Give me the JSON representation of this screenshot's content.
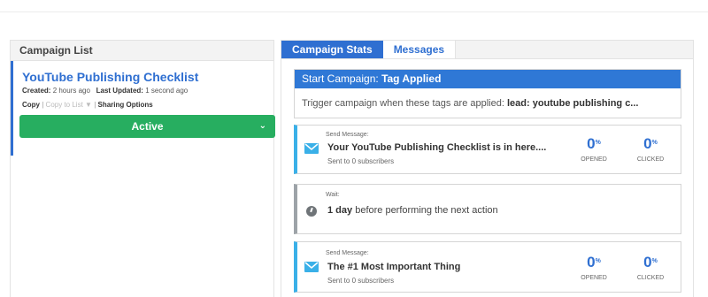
{
  "left": {
    "header": "Campaign List",
    "campaign": {
      "title": "YouTube Publishing Checklist",
      "created_label": "Created:",
      "created_value": "2 hours ago",
      "updated_label": "Last Updated:",
      "updated_value": "1 second ago",
      "copy": "Copy",
      "sep1": "|",
      "copy_to_list": "Copy to List",
      "filter_glyph": "▼",
      "sep2": "|",
      "sharing": "Sharing Options",
      "status_button": "Active",
      "status_chevron": "⌄"
    }
  },
  "tabs": [
    "Campaign Stats",
    "Messages"
  ],
  "start": {
    "prefix": "Start Campaign:",
    "trigger": "Tag Applied",
    "body_prefix": "Trigger campaign when these tags are applied:",
    "tag": "lead: youtube publishing c..."
  },
  "cards": [
    {
      "label": "Send Message:",
      "title": "Your YouTube Publishing Checklist is in here....",
      "sub": "Sent to 0 subscribers",
      "opened_value": "0",
      "opened_caption": "OPENED",
      "clicked_value": "0",
      "clicked_caption": "CLICKED",
      "percent": "%"
    },
    {
      "label": "Wait:",
      "duration": "1 day",
      "rest": "before performing the next action"
    },
    {
      "label": "Send Message:",
      "title": "The #1 Most Important Thing",
      "sub": "Sent to 0 subscribers",
      "opened_value": "0",
      "opened_caption": "OPENED",
      "clicked_value": "0",
      "clicked_caption": "CLICKED",
      "percent": "%"
    }
  ],
  "colors": {
    "accent": "#2f6fd1",
    "active_green": "#27ae60",
    "message_stripe": "#3ab0e8",
    "wait_stripe": "#9da3a8"
  },
  "icons": [
    "envelope-icon",
    "clock-icon",
    "chevron-down-icon",
    "filter-icon"
  ]
}
